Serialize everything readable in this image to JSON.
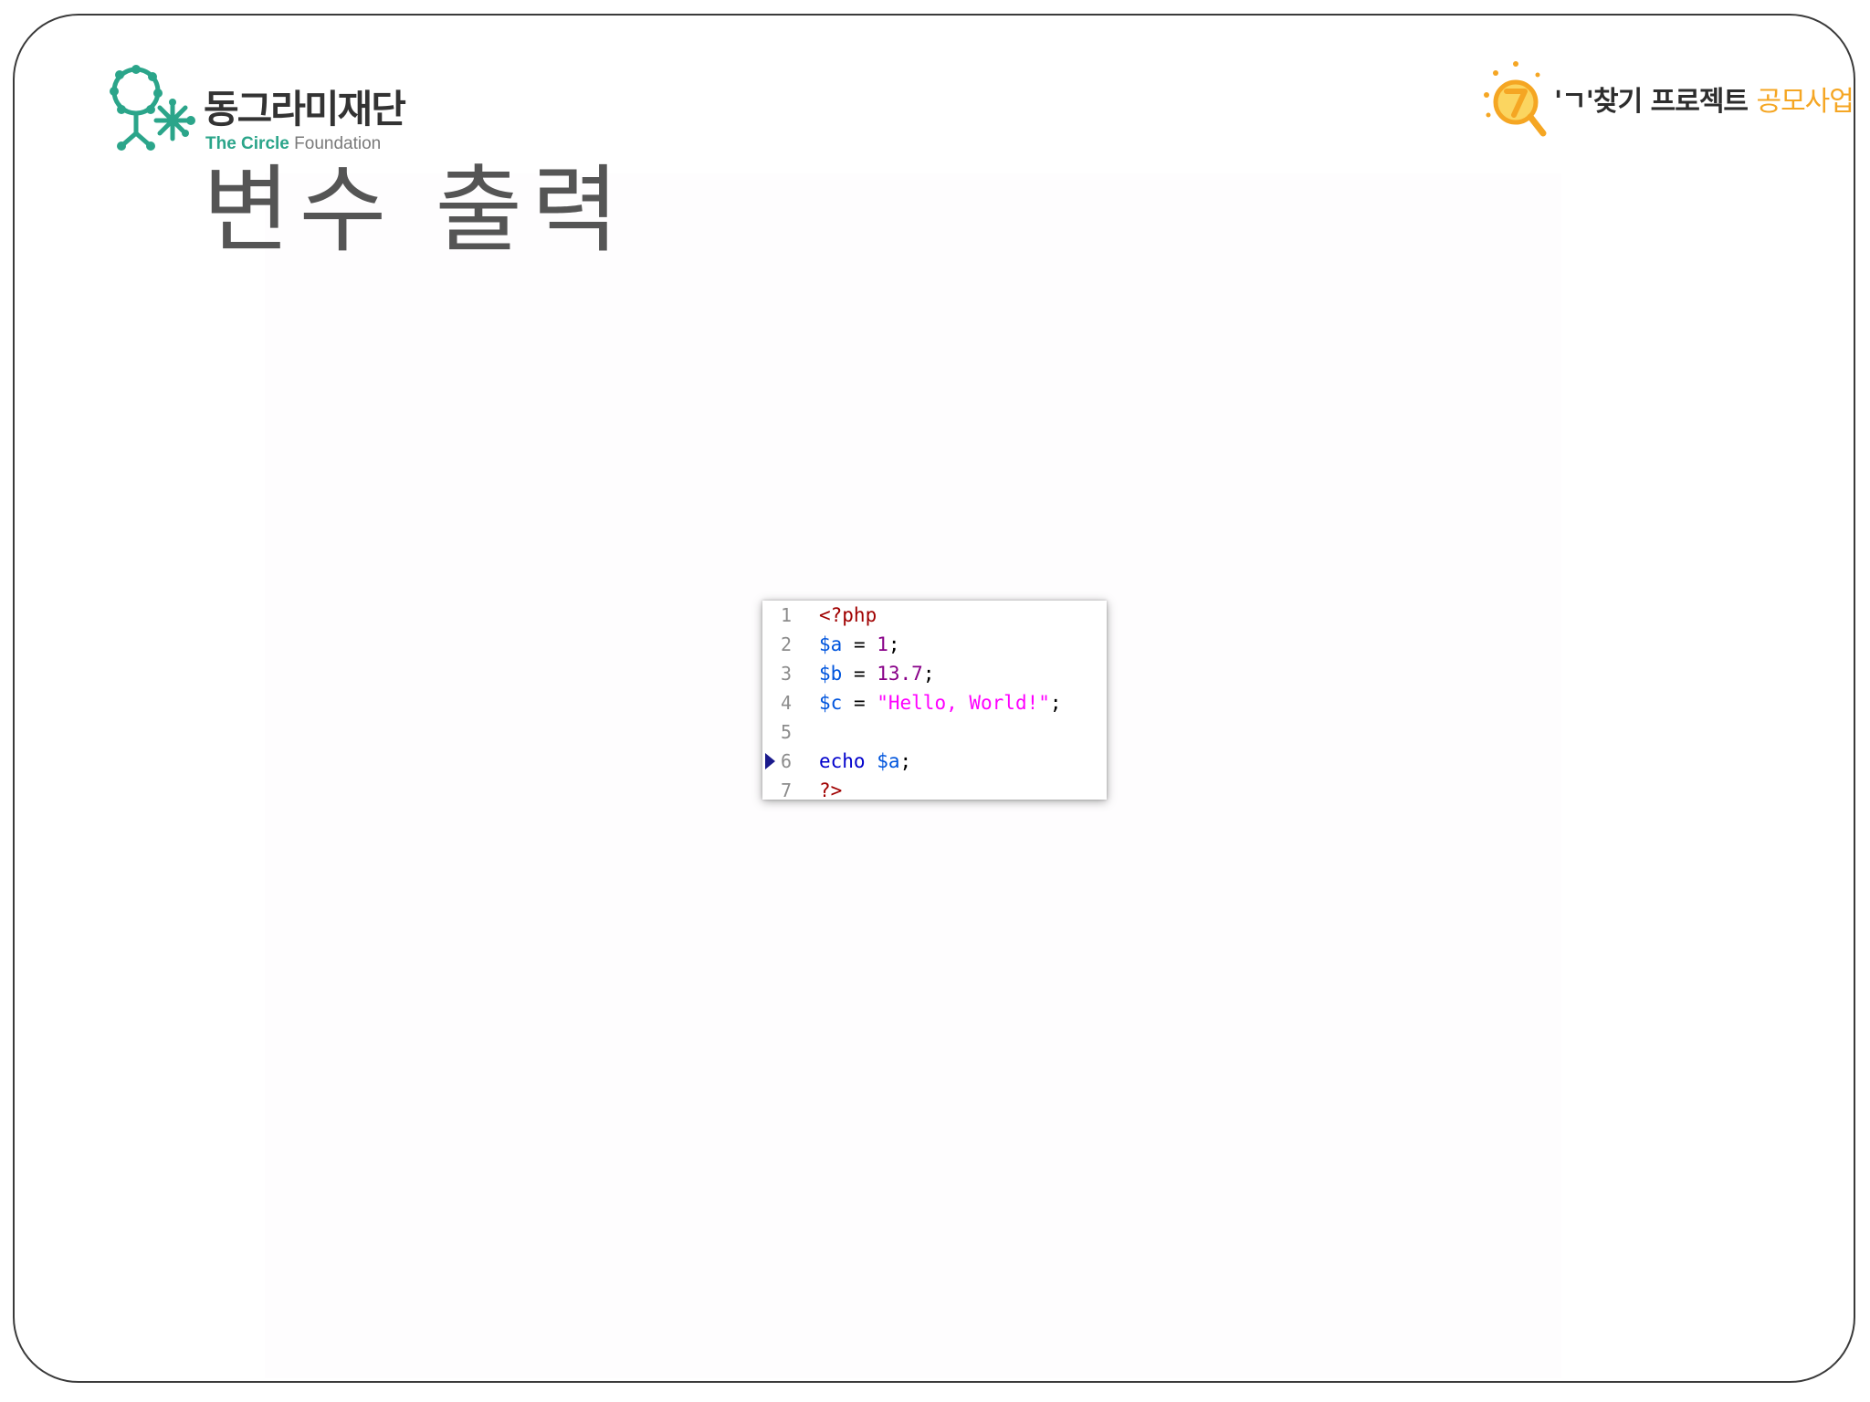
{
  "slide": {
    "title": "변수 출력"
  },
  "logo_left": {
    "korean_name": "동그라미재단",
    "english_name_accent": "The Circle",
    "english_name_rest": " Foundation",
    "color": "#2ba58a"
  },
  "logo_right": {
    "text_main": "'ㄱ'찾기 프로젝트 ",
    "text_accent": "공모사업",
    "accent_color": "#f5a623"
  },
  "code_editor": {
    "language": "php",
    "current_line": 6,
    "lines": [
      {
        "number": "1",
        "tokens": [
          {
            "text": "<?php",
            "kind": "tag"
          }
        ]
      },
      {
        "number": "2",
        "tokens": [
          {
            "text": "$a",
            "kind": "var"
          },
          {
            "text": " = ",
            "kind": "op"
          },
          {
            "text": "1",
            "kind": "num"
          },
          {
            "text": ";",
            "kind": "op"
          }
        ]
      },
      {
        "number": "3",
        "tokens": [
          {
            "text": "$b",
            "kind": "var"
          },
          {
            "text": " = ",
            "kind": "op"
          },
          {
            "text": "13.7",
            "kind": "num"
          },
          {
            "text": ";",
            "kind": "op"
          }
        ]
      },
      {
        "number": "4",
        "tokens": [
          {
            "text": "$c",
            "kind": "var"
          },
          {
            "text": " = ",
            "kind": "op"
          },
          {
            "text": "\"Hello, World!\"",
            "kind": "str"
          },
          {
            "text": ";",
            "kind": "op"
          }
        ]
      },
      {
        "number": "5",
        "tokens": []
      },
      {
        "number": "6",
        "tokens": [
          {
            "text": "echo",
            "kind": "kw"
          },
          {
            "text": " ",
            "kind": "op"
          },
          {
            "text": "$a",
            "kind": "var"
          },
          {
            "text": ";",
            "kind": "op"
          }
        ]
      },
      {
        "number": "7",
        "tokens": [
          {
            "text": "?>",
            "kind": "tag"
          }
        ]
      }
    ]
  }
}
